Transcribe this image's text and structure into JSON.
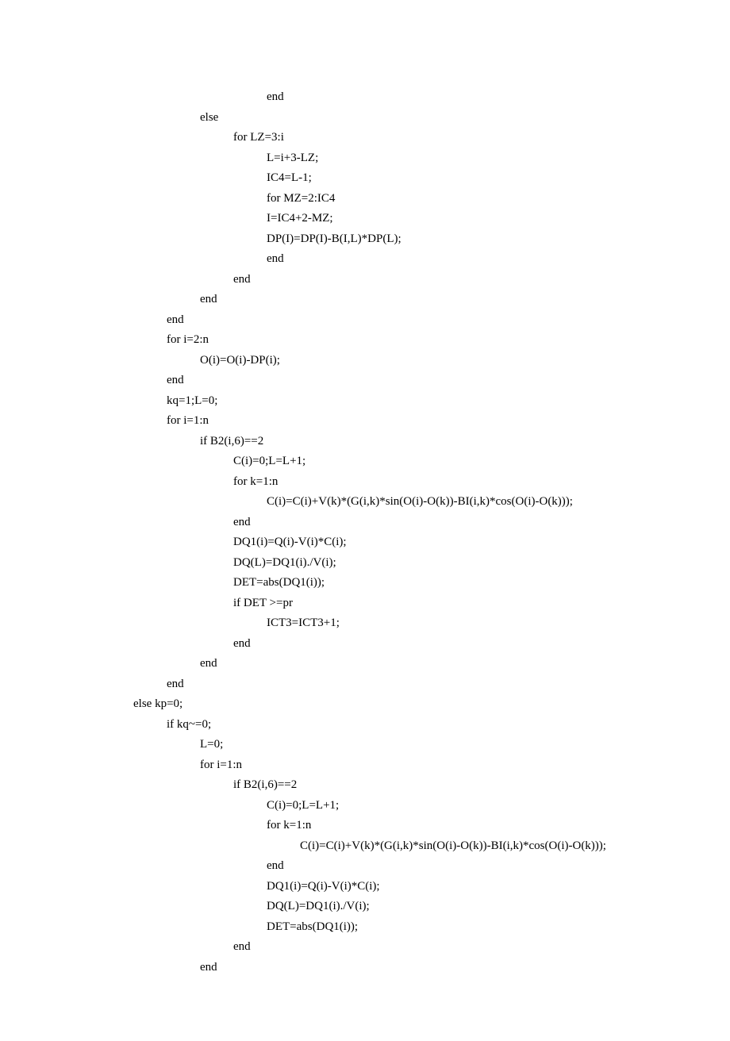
{
  "lines": [
    {
      "indent": 4,
      "text": "end"
    },
    {
      "indent": 2,
      "text": "else"
    },
    {
      "indent": 3,
      "text": "for LZ=3:i"
    },
    {
      "indent": 4,
      "text": "L=i+3-LZ;"
    },
    {
      "indent": 4,
      "text": "IC4=L-1;"
    },
    {
      "indent": 4,
      "text": "for MZ=2:IC4"
    },
    {
      "indent": 4,
      "text": "I=IC4+2-MZ;"
    },
    {
      "indent": 4,
      "text": "DP(I)=DP(I)-B(I,L)*DP(L);"
    },
    {
      "indent": 4,
      "text": "end"
    },
    {
      "indent": 3,
      "text": "end"
    },
    {
      "indent": 2,
      "text": "end"
    },
    {
      "indent": 1,
      "text": "end"
    },
    {
      "indent": 1,
      "text": "for i=2:n"
    },
    {
      "indent": 2,
      "text": "O(i)=O(i)-DP(i);"
    },
    {
      "indent": 1,
      "text": "end"
    },
    {
      "indent": 1,
      "text": "kq=1;L=0;"
    },
    {
      "indent": 1,
      "text": "for i=1:n"
    },
    {
      "indent": 2,
      "text": "if B2(i,6)==2"
    },
    {
      "indent": 3,
      "text": "C(i)=0;L=L+1;"
    },
    {
      "indent": 3,
      "text": "for k=1:n"
    },
    {
      "indent": 4,
      "text": "C(i)=C(i)+V(k)*(G(i,k)*sin(O(i)-O(k))-BI(i,k)*cos(O(i)-O(k)));"
    },
    {
      "indent": 3,
      "text": "end"
    },
    {
      "indent": 3,
      "text": "DQ1(i)=Q(i)-V(i)*C(i);"
    },
    {
      "indent": 3,
      "text": "DQ(L)=DQ1(i)./V(i);"
    },
    {
      "indent": 3,
      "text": "DET=abs(DQ1(i));"
    },
    {
      "indent": 3,
      "text": "if DET >=pr"
    },
    {
      "indent": 4,
      "text": "ICT3=ICT3+1;"
    },
    {
      "indent": 3,
      "text": "end"
    },
    {
      "indent": 2,
      "text": "end"
    },
    {
      "indent": 1,
      "text": "end"
    },
    {
      "indent": 0,
      "text": "else kp=0;"
    },
    {
      "indent": 1,
      "text": "if kq~=0;"
    },
    {
      "indent": 2,
      "text": "L=0;"
    },
    {
      "indent": 2,
      "text": "for i=1:n"
    },
    {
      "indent": 3,
      "text": "if B2(i,6)==2"
    },
    {
      "indent": 4,
      "text": "C(i)=0;L=L+1;"
    },
    {
      "indent": 4,
      "text": "for k=1:n"
    },
    {
      "indent": 5,
      "text": "C(i)=C(i)+V(k)*(G(i,k)*sin(O(i)-O(k))-BI(i,k)*cos(O(i)-O(k)));"
    },
    {
      "indent": 4,
      "text": "end"
    },
    {
      "indent": 4,
      "text": "DQ1(i)=Q(i)-V(i)*C(i);"
    },
    {
      "indent": 4,
      "text": "DQ(L)=DQ1(i)./V(i);"
    },
    {
      "indent": 4,
      "text": "DET=abs(DQ1(i));"
    },
    {
      "indent": 3,
      "text": "end"
    },
    {
      "indent": 2,
      "text": "end"
    }
  ]
}
